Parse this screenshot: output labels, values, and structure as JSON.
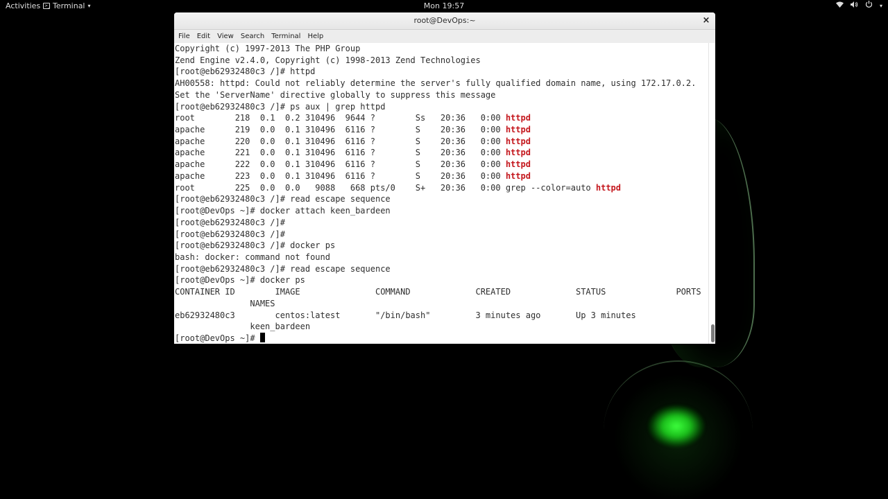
{
  "topbar": {
    "activities": "Activities",
    "app_menu": "Terminal",
    "clock": "Mon 19:57",
    "tray_icons": [
      "wifi-icon",
      "volume-icon",
      "power-icon"
    ]
  },
  "window": {
    "title": "root@DevOps:~",
    "close_glyph": "×"
  },
  "menu": [
    "File",
    "Edit",
    "View",
    "Search",
    "Terminal",
    "Help"
  ],
  "terminal": {
    "lines": [
      {
        "text": "Copyright (c) 1997-2013 The PHP Group"
      },
      {
        "text": "Zend Engine v2.4.0, Copyright (c) 1998-2013 Zend Technologies"
      },
      {
        "text": "[root@eb62932480c3 /]# httpd"
      },
      {
        "text": "AH00558: httpd: Could not reliably determine the server's fully qualified domain name, using 172.17.0.2."
      },
      {
        "text": "Set the 'ServerName' directive globally to suppress this message"
      },
      {
        "text": "[root@eb62932480c3 /]# ps aux | grep httpd"
      },
      {
        "text": "root        218  0.1  0.2 310496  9644 ?        Ss   20:36   0:00 ",
        "hl": "httpd"
      },
      {
        "text": "apache      219  0.0  0.1 310496  6116 ?        S    20:36   0:00 ",
        "hl": "httpd"
      },
      {
        "text": "apache      220  0.0  0.1 310496  6116 ?        S    20:36   0:00 ",
        "hl": "httpd"
      },
      {
        "text": "apache      221  0.0  0.1 310496  6116 ?        S    20:36   0:00 ",
        "hl": "httpd"
      },
      {
        "text": "apache      222  0.0  0.1 310496  6116 ?        S    20:36   0:00 ",
        "hl": "httpd"
      },
      {
        "text": "apache      223  0.0  0.1 310496  6116 ?        S    20:36   0:00 ",
        "hl": "httpd"
      },
      {
        "text": "root        225  0.0  0.0   9088   668 pts/0    S+   20:36   0:00 grep --color=auto ",
        "hl": "httpd"
      },
      {
        "text": "[root@eb62932480c3 /]# read escape sequence"
      },
      {
        "text": "[root@DevOps ~]# docker attach keen_bardeen"
      },
      {
        "text": "[root@eb62932480c3 /]#"
      },
      {
        "text": "[root@eb62932480c3 /]#"
      },
      {
        "text": "[root@eb62932480c3 /]# docker ps"
      },
      {
        "text": "bash: docker: command not found"
      },
      {
        "text": "[root@eb62932480c3 /]# read escape sequence"
      },
      {
        "text": "[root@DevOps ~]# docker ps"
      },
      {
        "text": "CONTAINER ID        IMAGE               COMMAND             CREATED             STATUS              PORTS"
      },
      {
        "text": "               NAMES"
      },
      {
        "text": "eb62932480c3        centos:latest       \"/bin/bash\"         3 minutes ago       Up 3 minutes"
      },
      {
        "text": "               keen_bardeen"
      }
    ],
    "prompt": "[root@DevOps ~]# "
  }
}
